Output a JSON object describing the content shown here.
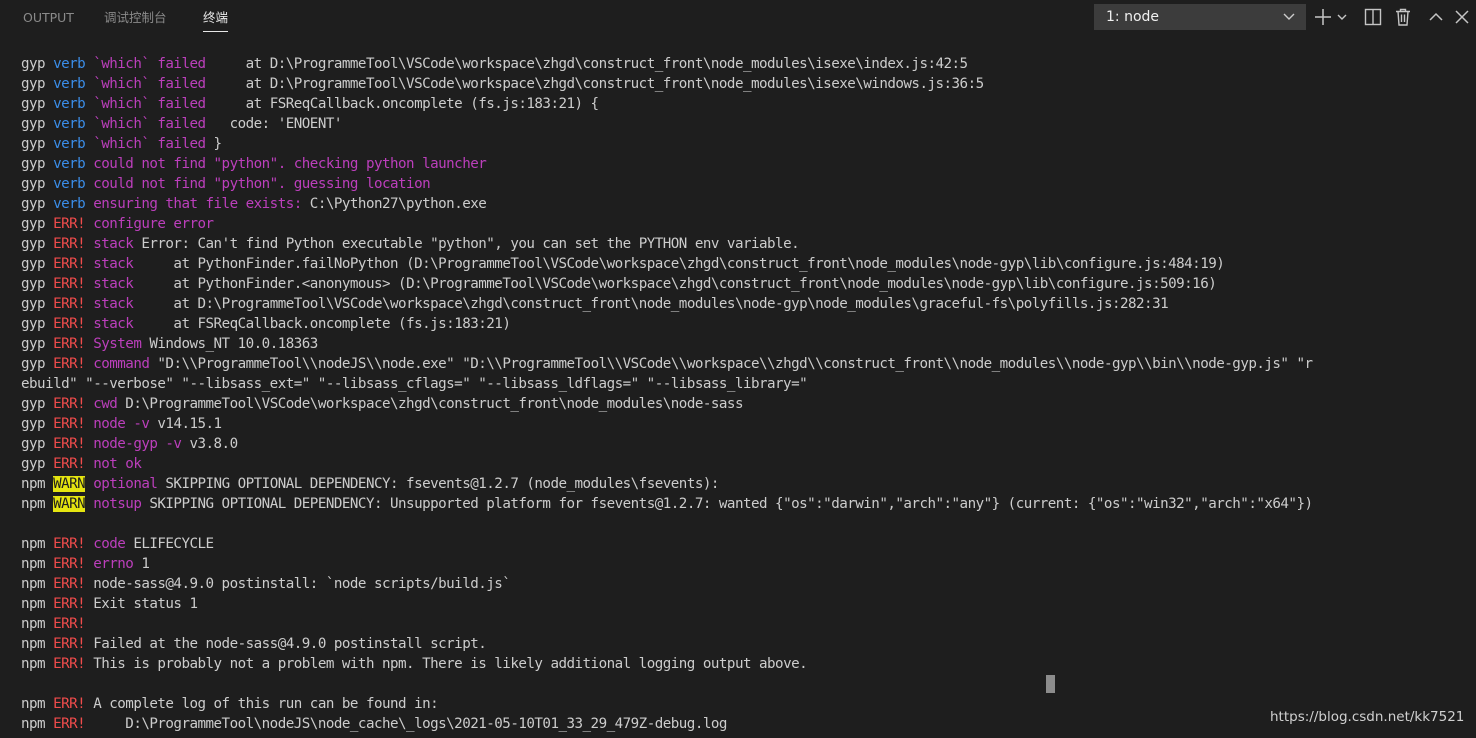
{
  "tabs": [
    {
      "label": "OUTPUT",
      "active": false
    },
    {
      "label": "调试控制台",
      "active": false
    },
    {
      "label": "终端",
      "active": true
    }
  ],
  "terminal_selector": {
    "selected": "1: node"
  },
  "toolbar_icons": [
    "plus-icon",
    "chevron-down-icon",
    "split-terminal-icon",
    "trash-icon",
    "chevron-up-icon",
    "close-icon"
  ],
  "colors": {
    "background": "#1e1e1e",
    "text": "#cccccc",
    "verb": "#3b8eea",
    "err": "#f14c4c",
    "magenta": "#bc3fbc",
    "warn_bg": "#e5e510"
  },
  "terminal_lines": [
    [
      {
        "t": "gyp ",
        "c": "g"
      },
      {
        "t": "verb",
        "c": "verb"
      },
      {
        "t": " `which` failed",
        "c": "mag"
      },
      {
        "t": "     at D:\\ProgrammeTool\\VSCode\\workspace\\zhgd\\construct_front\\node_modules\\isexe\\index.js:42:5",
        "c": "g"
      }
    ],
    [
      {
        "t": "gyp ",
        "c": "g"
      },
      {
        "t": "verb",
        "c": "verb"
      },
      {
        "t": " `which` failed",
        "c": "mag"
      },
      {
        "t": "     at D:\\ProgrammeTool\\VSCode\\workspace\\zhgd\\construct_front\\node_modules\\isexe\\windows.js:36:5",
        "c": "g"
      }
    ],
    [
      {
        "t": "gyp ",
        "c": "g"
      },
      {
        "t": "verb",
        "c": "verb"
      },
      {
        "t": " `which` failed",
        "c": "mag"
      },
      {
        "t": "     at FSReqCallback.oncomplete (fs.js:183:21) {",
        "c": "g"
      }
    ],
    [
      {
        "t": "gyp ",
        "c": "g"
      },
      {
        "t": "verb",
        "c": "verb"
      },
      {
        "t": " `which` failed",
        "c": "mag"
      },
      {
        "t": "   code: 'ENOENT'",
        "c": "g"
      }
    ],
    [
      {
        "t": "gyp ",
        "c": "g"
      },
      {
        "t": "verb",
        "c": "verb"
      },
      {
        "t": " `which` failed",
        "c": "mag"
      },
      {
        "t": " }",
        "c": "g"
      }
    ],
    [
      {
        "t": "gyp ",
        "c": "g"
      },
      {
        "t": "verb",
        "c": "verb"
      },
      {
        "t": " could not find \"python\". checking python launcher",
        "c": "mag"
      }
    ],
    [
      {
        "t": "gyp ",
        "c": "g"
      },
      {
        "t": "verb",
        "c": "verb"
      },
      {
        "t": " could not find \"python\". guessing location",
        "c": "mag"
      }
    ],
    [
      {
        "t": "gyp ",
        "c": "g"
      },
      {
        "t": "verb",
        "c": "verb"
      },
      {
        "t": " ensuring that file exists:",
        "c": "mag"
      },
      {
        "t": " C:\\Python27\\python.exe",
        "c": "g"
      }
    ],
    [
      {
        "t": "gyp ",
        "c": "g"
      },
      {
        "t": "ERR!",
        "c": "err"
      },
      {
        "t": " configure error",
        "c": "mag"
      }
    ],
    [
      {
        "t": "gyp ",
        "c": "g"
      },
      {
        "t": "ERR!",
        "c": "err"
      },
      {
        "t": " stack",
        "c": "mag"
      },
      {
        "t": " Error: Can't find Python executable \"python\", you can set the PYTHON env variable.",
        "c": "g"
      }
    ],
    [
      {
        "t": "gyp ",
        "c": "g"
      },
      {
        "t": "ERR!",
        "c": "err"
      },
      {
        "t": " stack",
        "c": "mag"
      },
      {
        "t": "     at PythonFinder.failNoPython (D:\\ProgrammeTool\\VSCode\\workspace\\zhgd\\construct_front\\node_modules\\node-gyp\\lib\\configure.js:484:19)",
        "c": "g"
      }
    ],
    [
      {
        "t": "gyp ",
        "c": "g"
      },
      {
        "t": "ERR!",
        "c": "err"
      },
      {
        "t": " stack",
        "c": "mag"
      },
      {
        "t": "     at PythonFinder.<anonymous> (D:\\ProgrammeTool\\VSCode\\workspace\\zhgd\\construct_front\\node_modules\\node-gyp\\lib\\configure.js:509:16)",
        "c": "g"
      }
    ],
    [
      {
        "t": "gyp ",
        "c": "g"
      },
      {
        "t": "ERR!",
        "c": "err"
      },
      {
        "t": " stack",
        "c": "mag"
      },
      {
        "t": "     at D:\\ProgrammeTool\\VSCode\\workspace\\zhgd\\construct_front\\node_modules\\node-gyp\\node_modules\\graceful-fs\\polyfills.js:282:31",
        "c": "g"
      }
    ],
    [
      {
        "t": "gyp ",
        "c": "g"
      },
      {
        "t": "ERR!",
        "c": "err"
      },
      {
        "t": " stack",
        "c": "mag"
      },
      {
        "t": "     at FSReqCallback.oncomplete (fs.js:183:21)",
        "c": "g"
      }
    ],
    [
      {
        "t": "gyp ",
        "c": "g"
      },
      {
        "t": "ERR!",
        "c": "err"
      },
      {
        "t": " System",
        "c": "mag"
      },
      {
        "t": " Windows_NT 10.0.18363",
        "c": "g"
      }
    ],
    [
      {
        "t": "gyp ",
        "c": "g"
      },
      {
        "t": "ERR!",
        "c": "err"
      },
      {
        "t": " command",
        "c": "mag"
      },
      {
        "t": " \"D:\\\\ProgrammeTool\\\\nodeJS\\\\node.exe\" \"D:\\\\ProgrammeTool\\\\VSCode\\\\workspace\\\\zhgd\\\\construct_front\\\\node_modules\\\\node-gyp\\\\bin\\\\node-gyp.js\" \"r",
        "c": "g"
      }
    ],
    [
      {
        "t": "ebuild\" \"--verbose\" \"--libsass_ext=\" \"--libsass_cflags=\" \"--libsass_ldflags=\" \"--libsass_library=\"",
        "c": "g"
      }
    ],
    [
      {
        "t": "gyp ",
        "c": "g"
      },
      {
        "t": "ERR!",
        "c": "err"
      },
      {
        "t": " cwd",
        "c": "mag"
      },
      {
        "t": " D:\\ProgrammeTool\\VSCode\\workspace\\zhgd\\construct_front\\node_modules\\node-sass",
        "c": "g"
      }
    ],
    [
      {
        "t": "gyp ",
        "c": "g"
      },
      {
        "t": "ERR!",
        "c": "err"
      },
      {
        "t": " node -v",
        "c": "mag"
      },
      {
        "t": " v14.15.1",
        "c": "g"
      }
    ],
    [
      {
        "t": "gyp ",
        "c": "g"
      },
      {
        "t": "ERR!",
        "c": "err"
      },
      {
        "t": " node-gyp -v",
        "c": "mag"
      },
      {
        "t": " v3.8.0",
        "c": "g"
      }
    ],
    [
      {
        "t": "gyp ",
        "c": "g"
      },
      {
        "t": "ERR!",
        "c": "err"
      },
      {
        "t": " not ok",
        "c": "mag"
      }
    ],
    [
      {
        "t": "npm ",
        "c": "g"
      },
      {
        "t": "WARN",
        "c": "warn"
      },
      {
        "t": " optional",
        "c": "mag"
      },
      {
        "t": " SKIPPING OPTIONAL DEPENDENCY: fsevents@1.2.7 (node_modules\\fsevents):",
        "c": "g"
      }
    ],
    [
      {
        "t": "npm ",
        "c": "g"
      },
      {
        "t": "WARN",
        "c": "warn"
      },
      {
        "t": " notsup",
        "c": "mag"
      },
      {
        "t": " SKIPPING OPTIONAL DEPENDENCY: Unsupported platform for fsevents@1.2.7: wanted {\"os\":\"darwin\",\"arch\":\"any\"} (current: {\"os\":\"win32\",\"arch\":\"x64\"})",
        "c": "g"
      }
    ],
    [],
    [
      {
        "t": "npm ",
        "c": "g"
      },
      {
        "t": "ERR!",
        "c": "err"
      },
      {
        "t": " code",
        "c": "mag"
      },
      {
        "t": " ELIFECYCLE",
        "c": "g"
      }
    ],
    [
      {
        "t": "npm ",
        "c": "g"
      },
      {
        "t": "ERR!",
        "c": "err"
      },
      {
        "t": " errno",
        "c": "mag"
      },
      {
        "t": " 1",
        "c": "g"
      }
    ],
    [
      {
        "t": "npm ",
        "c": "g"
      },
      {
        "t": "ERR!",
        "c": "err"
      },
      {
        "t": " node-sass@4.9.0 postinstall: `node scripts/build.js`",
        "c": "g"
      }
    ],
    [
      {
        "t": "npm ",
        "c": "g"
      },
      {
        "t": "ERR!",
        "c": "err"
      },
      {
        "t": " Exit status 1",
        "c": "g"
      }
    ],
    [
      {
        "t": "npm ",
        "c": "g"
      },
      {
        "t": "ERR!",
        "c": "err"
      }
    ],
    [
      {
        "t": "npm ",
        "c": "g"
      },
      {
        "t": "ERR!",
        "c": "err"
      },
      {
        "t": " Failed at the node-sass@4.9.0 postinstall script.",
        "c": "g"
      }
    ],
    [
      {
        "t": "npm ",
        "c": "g"
      },
      {
        "t": "ERR!",
        "c": "err"
      },
      {
        "t": " This is probably not a problem with npm. There is likely additional logging output above.",
        "c": "g"
      }
    ],
    [],
    [
      {
        "t": "npm ",
        "c": "g"
      },
      {
        "t": "ERR!",
        "c": "err"
      },
      {
        "t": " A complete log of this run can be found in:",
        "c": "g"
      }
    ],
    [
      {
        "t": "npm ",
        "c": "g"
      },
      {
        "t": "ERR!",
        "c": "err"
      },
      {
        "t": "     D:\\ProgrammeTool\\nodeJS\\node_cache\\_logs\\2021-05-10T01_33_29_479Z-debug.log",
        "c": "g"
      }
    ]
  ],
  "watermark": "https://blog.csdn.net/kk7521"
}
